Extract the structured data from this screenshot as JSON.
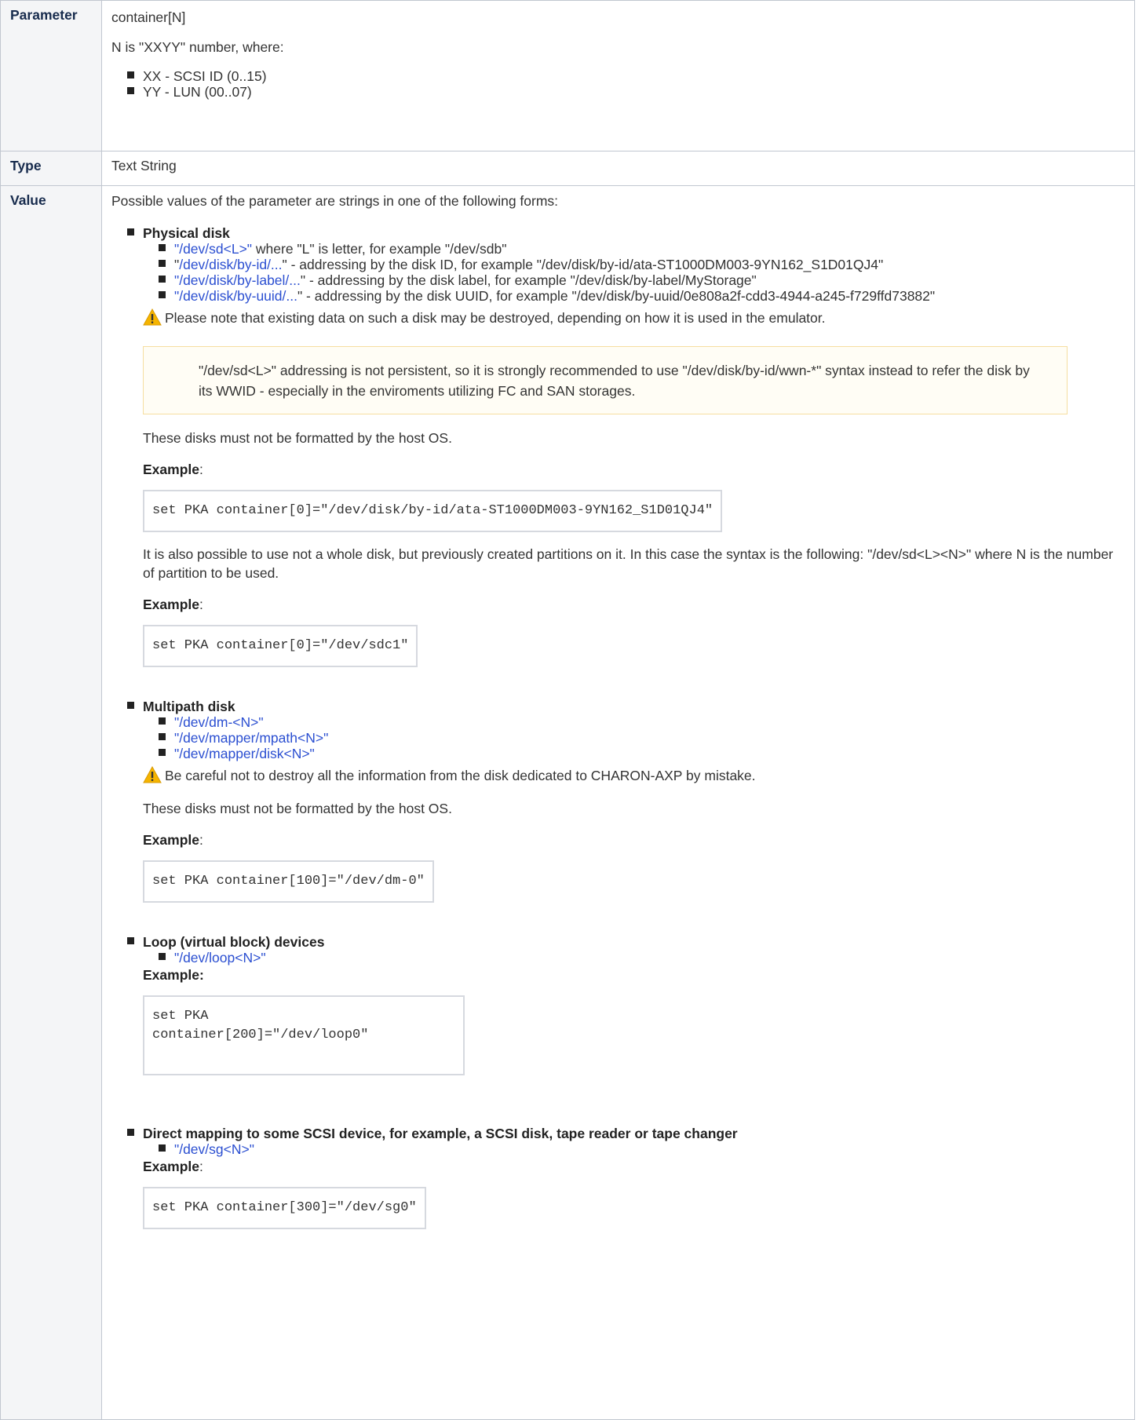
{
  "rows": {
    "parameter": {
      "header": "Parameter",
      "name": "container[N]",
      "desc": "N is \"XXYY\" number, where:",
      "items": [
        "XX - SCSI ID (0..15)",
        "YY - LUN (00..07)"
      ]
    },
    "type": {
      "header": "Type",
      "value": "Text String"
    },
    "value": {
      "header": "Value",
      "intro": "Possible values of the parameter are strings in one of the following forms:"
    }
  },
  "physical": {
    "title": "Physical disk",
    "items": [
      {
        "link": "\"/dev/sd<L>\"",
        "text": " where \"L\" is letter, for example \"/dev/sdb\""
      },
      {
        "pre": "\"",
        "link": "/dev/disk/by-id/...",
        "text": "\" - addressing by the disk ID, for example \"/dev/disk/by-id/ata-ST1000DM003-9YN162_S1D01QJ4\""
      },
      {
        "link": "\"/dev/disk/by-label/...",
        "text": "\" - addressing by the disk label, for example \"/dev/disk/by-label/MyStorage\""
      },
      {
        "link": "\"/dev/disk/by-uuid/...",
        "text": "\" - addressing by the disk UUID, for example \"/dev/disk/by-uuid/0e808a2f-cdd3-4944-a245-f729ffd73882\""
      }
    ],
    "warning": "Please note that existing data on such a disk may be destroyed, depending on how it is used in the emulator.",
    "note": "\"/dev/sd<L>\" addressing is not persistent, so it is strongly recommended to use \"/dev/disk/by-id/wwn-*\" syntax instead to refer the disk by its WWID - especially in the enviroments utilizing FC and SAN storages.",
    "no_format": " These disks must not be formatted by the host OS.",
    "example_label": "Example",
    "example_colon": ":",
    "example1": "set PKA container[0]=\"/dev/disk/by-id/ata-ST1000DM003-9YN162_S1D01QJ4\"",
    "partition_text": "It is also possible to use not a whole disk, but previously created partitions on it. In this case the syntax is the following: \"/dev/sd<L><N>\" where N is the number of partition to be used.",
    "example2": "set PKA container[0]=\"/dev/sdc1\""
  },
  "multipath": {
    "title": "Multipath disk",
    "items": [
      "\"/dev/dm-<N>\"",
      "\"/dev/mapper/mpath<N>\"",
      "\"/dev/mapper/disk<N>\""
    ],
    "warning": "Be careful not to destroy all the information from the disk dedicated to CHARON-AXP by mistake.",
    "no_format": "These disks must not be formatted by the host OS.",
    "example_label": "Example",
    "example_colon": ":",
    "example": "set PKA container[100]=\"/dev/dm-0\""
  },
  "loop": {
    "title": "Loop (virtual block) devices",
    "item": "\"/dev/loop<N>\"",
    "example_label": "Example:",
    "example": "set PKA\ncontainer[200]=\"/dev/loop0\"\n "
  },
  "direct": {
    "title": "Direct mapping to some SCSI device, for example, a SCSI disk, tape reader or tape changer",
    "item": "\"/dev/sg<N>\"",
    "example_label": "Example",
    "example_colon": ":",
    "example": "set PKA container[300]=\"/dev/sg0\""
  },
  "colors": {
    "link": "#2b4fd1",
    "header_bg": "#f4f5f7",
    "warning": "#f5b400"
  },
  "icons": {
    "warning": "warning-icon"
  }
}
